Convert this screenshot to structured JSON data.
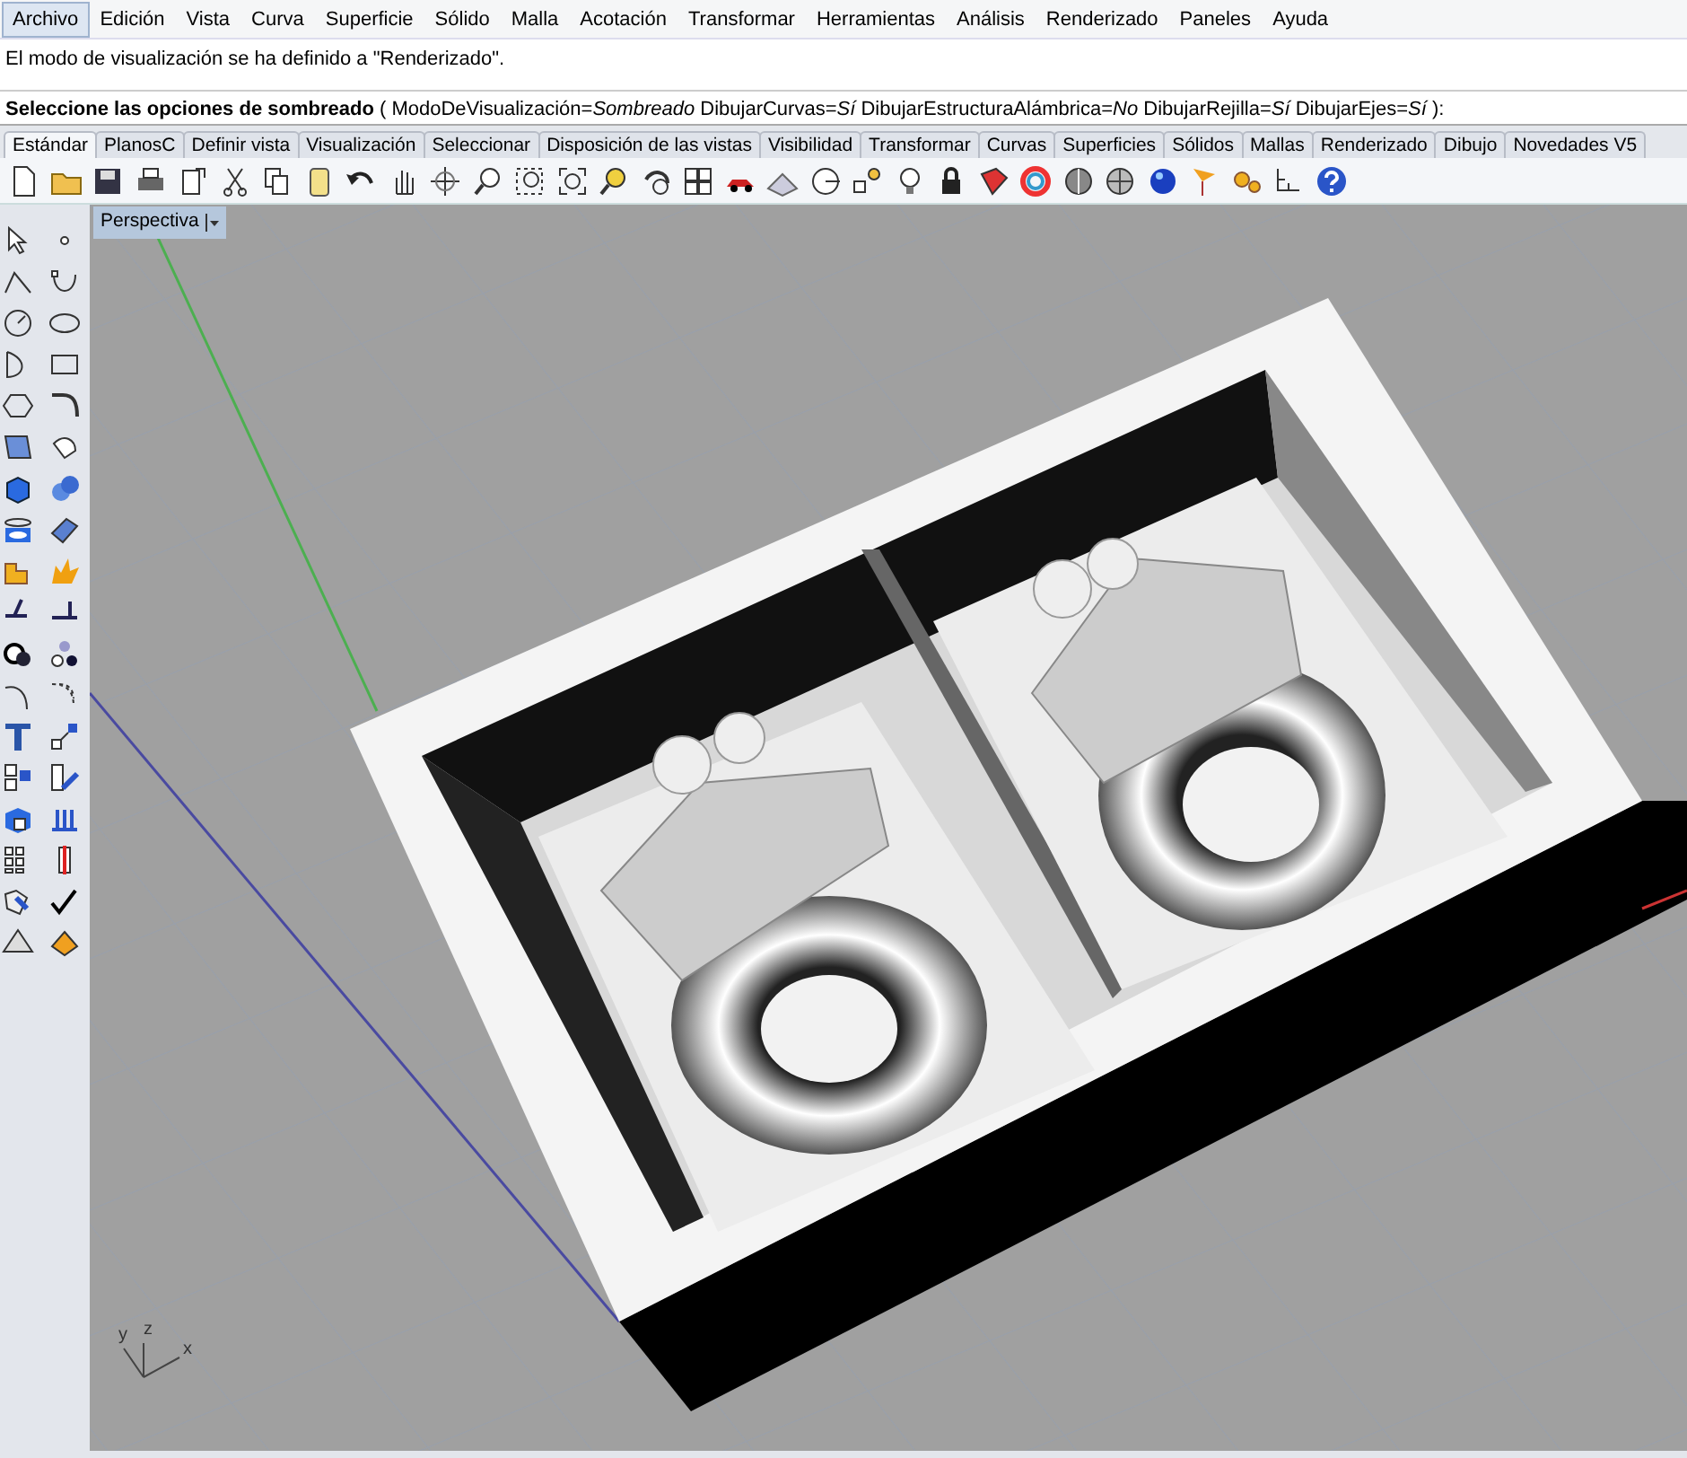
{
  "menu": [
    {
      "label": "Archivo",
      "selected": true
    },
    {
      "label": "Edición",
      "selected": false
    },
    {
      "label": "Vista",
      "selected": false
    },
    {
      "label": "Curva",
      "selected": false
    },
    {
      "label": "Superficie",
      "selected": false
    },
    {
      "label": "Sólido",
      "selected": false
    },
    {
      "label": "Malla",
      "selected": false
    },
    {
      "label": "Acotación",
      "selected": false
    },
    {
      "label": "Transformar",
      "selected": false
    },
    {
      "label": "Herramientas",
      "selected": false
    },
    {
      "label": "Análisis",
      "selected": false
    },
    {
      "label": "Renderizado",
      "selected": false
    },
    {
      "label": "Paneles",
      "selected": false
    },
    {
      "label": "Ayuda",
      "selected": false
    }
  ],
  "command_history": "El modo de visualización se ha definido a \"Renderizado\".",
  "command_prompt": "**Seleccione las opciones de sombreado** ( ModoDeVisualización=*Sombreado*  DibujarCurvas=*Sí*  DibujarEstructuraAlámbrica=*No*  DibujarRejilla=*Sí*  DibujarEjes=*Sí* ):",
  "toolbar_tabs": [
    {
      "label": "Estándar",
      "selected": true
    },
    {
      "label": "PlanosC",
      "selected": false
    },
    {
      "label": "Definir vista",
      "selected": false
    },
    {
      "label": "Visualización",
      "selected": false
    },
    {
      "label": "Seleccionar",
      "selected": false
    },
    {
      "label": "Disposición de las vistas",
      "selected": false
    },
    {
      "label": "Visibilidad",
      "selected": false
    },
    {
      "label": "Transformar",
      "selected": false
    },
    {
      "label": "Curvas",
      "selected": false
    },
    {
      "label": "Superficies",
      "selected": false
    },
    {
      "label": "Sólidos",
      "selected": false
    },
    {
      "label": "Mallas",
      "selected": false
    },
    {
      "label": "Renderizado",
      "selected": false
    },
    {
      "label": "Dibujo",
      "selected": false
    },
    {
      "label": "Novedades V5",
      "selected": false
    }
  ],
  "viewport": {
    "title": "Perspectiva",
    "axis_labels": [
      "y",
      "z",
      "x"
    ]
  }
}
